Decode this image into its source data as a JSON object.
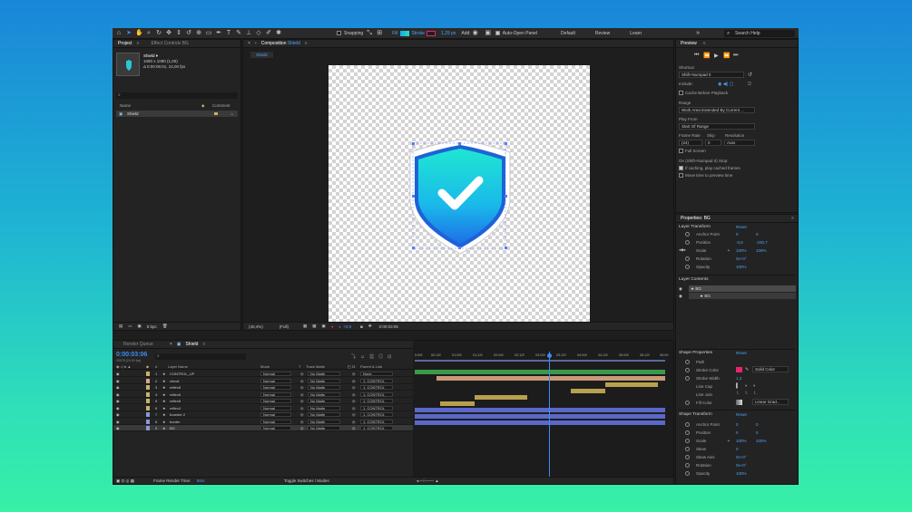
{
  "toolbar": {
    "snapping": "Snapping",
    "fill": "Fill",
    "stroke": "Stroke",
    "stroke_width": "1,29 px",
    "add": "Add:",
    "auto_open": "Auto-Open Panel",
    "workspaces": [
      "Default",
      "Review",
      "Learn"
    ],
    "search_placeholder": "Search Help",
    "fill_color": "#1ea6e8",
    "stroke_color": "#e8246a"
  },
  "project": {
    "tabs": [
      "Project",
      "Effect Controls BG"
    ],
    "comp_name": "Shield ▾",
    "comp_size": "1080 x 1080 (1,00)",
    "comp_duration": "Δ 0:00:06:01, 24,00 fps",
    "col_name": "Name",
    "col_comment": "Comment",
    "item_name": "Shield"
  },
  "composition": {
    "tab": "Composition",
    "tab_name": "Shield",
    "sub_tab": "Shield",
    "zoom": "(40,4%)",
    "quality": "(Full)",
    "exposure": "+0,0",
    "timecode": "0:00:03:06"
  },
  "timeline": {
    "tabs": [
      "Render Queue",
      "Shield"
    ],
    "current_time": "0:00:03:06",
    "fps_note": "00078 (24.00 fps)",
    "headers": {
      "num": "#",
      "layer_name": "Layer Name",
      "mode": "Mode",
      "t": "T",
      "track_matte": "Track Matte",
      "parent": "Parent & Link"
    },
    "ruler": [
      "0:00f",
      "00:12f",
      "01:00f",
      "01:12f",
      "02:00f",
      "02:12f",
      "03:00f",
      "03:12f",
      "04:00f",
      "04:12f",
      "05:00f",
      "05:12f",
      "06:00"
    ],
    "layers": [
      {
        "num": "1",
        "name": "CONTROL_UP",
        "mode": "Normal",
        "matte": "No Matte",
        "parent": "None",
        "color": "#c9b36a"
      },
      {
        "num": "2",
        "name": "check",
        "mode": "Normal",
        "matte": "No Matte",
        "parent": "1. CONTROL",
        "color": "#d8a880"
      },
      {
        "num": "3",
        "name": "reflex8",
        "mode": "Normal",
        "matte": "No Matte",
        "parent": "1. CONTROL",
        "color": "#c9b36a"
      },
      {
        "num": "4",
        "name": "reflex6",
        "mode": "Normal",
        "matte": "No Matte",
        "parent": "1. CONTROL",
        "color": "#c9b36a"
      },
      {
        "num": "5",
        "name": "reflex8",
        "mode": "Normal",
        "matte": "No Matte",
        "parent": "1. CONTROL",
        "color": "#c9b36a"
      },
      {
        "num": "6",
        "name": "reflex4",
        "mode": "Normal",
        "matte": "No Matte",
        "parent": "1. CONTROL",
        "color": "#c9b36a"
      },
      {
        "num": "7",
        "name": "boarder 2",
        "mode": "Normal",
        "matte": "No Matte",
        "parent": "1. CONTROL",
        "color": "#8a96d8"
      },
      {
        "num": "8",
        "name": "border",
        "mode": "Normal",
        "matte": "No Matte",
        "parent": "1. CONTROL",
        "color": "#8a96d8"
      },
      {
        "num": "9",
        "name": "BG",
        "mode": "Normal",
        "matte": "No Matte",
        "parent": "1. CONTROL",
        "color": "#8a96d8"
      }
    ],
    "frame_render_label": "Frame Render Time:",
    "frame_render_value": "8ms",
    "toggle_label": "Toggle Switches / Modes"
  },
  "preview": {
    "title": "Preview",
    "shortcut_label": "Shortcut",
    "shortcut_value": "Shift+Numpad 0",
    "include_label": "Include:",
    "cache_label": "Cache Before Playback",
    "range_label": "Range",
    "range_value": "Work Area Extended By Current ...",
    "play_from_label": "Play From",
    "play_from_value": "Start Of Range",
    "frame_rate_label": "Frame Rate",
    "skip_label": "Skip",
    "resolution_label": "Resolution",
    "frame_rate_value": "(24)",
    "skip_value": "0",
    "resolution_value": "Auto",
    "full_screen_label": "Full Screen",
    "stop_label": "On (Shift+Numpad 0) Stop:",
    "if_caching_label": "If caching, play cached frames",
    "move_time_label": "Move time to preview time"
  },
  "properties": {
    "title": "Properties: BG",
    "layer_transform": "Layer Transform",
    "reset": "Reset",
    "anchor_label": "Anchor Point",
    "anchor_x": "0",
    "anchor_y": "0",
    "position_label": "Position",
    "position_x": "-3,6",
    "position_y": "-230,7",
    "scale_label": "Scale",
    "scale_x": "100%",
    "scale_y": "100%",
    "rotation_label": "Rotation",
    "rotation_value": "0x+0°",
    "opacity_label": "Opacity",
    "opacity_value": "100%",
    "layer_contents": "Layer Contents",
    "contents": [
      "BG",
      "BG"
    ],
    "shape_properties": "Shape Properties",
    "path_label": "Path",
    "stroke_color_label": "Stroke Color",
    "stroke_type": "Solid Color",
    "stroke_width_label": "Stroke Width",
    "stroke_width_value": "1,3",
    "line_cap_label": "Line Cap",
    "line_join_label": "Line Join",
    "fill_color_label": "Fill Color",
    "fill_type": "Linear Grad...",
    "shape_transform": "Shape Transform",
    "st_anchor_label": "Anchor Point",
    "st_anchor_x": "0",
    "st_anchor_y": "0",
    "st_position_label": "Position",
    "st_position_x": "0",
    "st_position_y": "0",
    "st_scale_label": "Scale",
    "st_scale_x": "100%",
    "st_scale_y": "100%",
    "skew_label": "Skew",
    "skew_value": "0",
    "skew_axis_label": "Skew Axis",
    "skew_axis_value": "0x+0°",
    "st_rotation_label": "Rotation",
    "st_rotation_value": "0x+0°",
    "st_opacity_label": "Opacity",
    "st_opacity_value": "100%"
  }
}
